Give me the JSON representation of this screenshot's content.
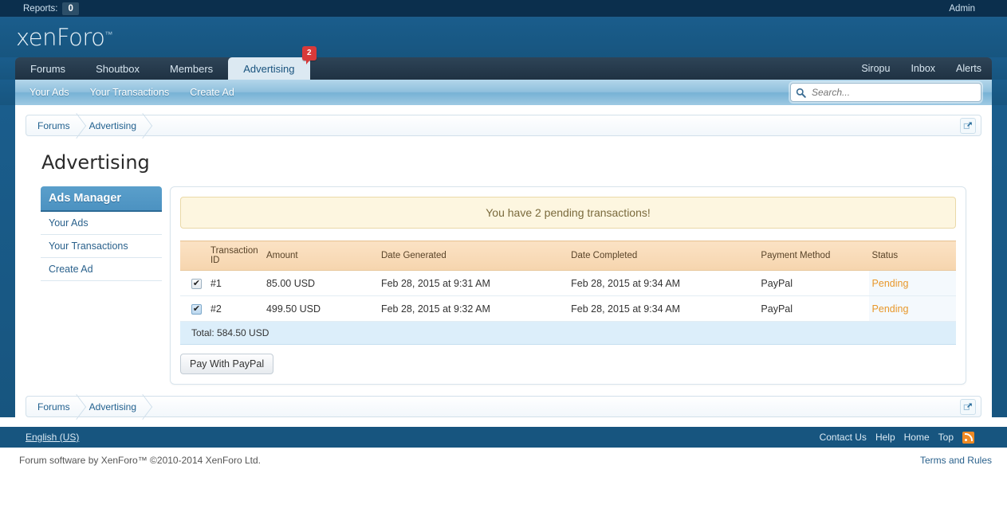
{
  "admin_bar": {
    "reports_label": "Reports:",
    "reports_count": "0",
    "admin_link": "Admin"
  },
  "header": {
    "logo_text": "xenForo",
    "logo_tm": "™"
  },
  "nav": {
    "tabs": [
      {
        "label": "Forums",
        "selected": false
      },
      {
        "label": "Shoutbox",
        "selected": false
      },
      {
        "label": "Members",
        "selected": false
      },
      {
        "label": "Advertising",
        "selected": true,
        "badge": "2"
      }
    ],
    "right_tabs": [
      {
        "label": "Siropu"
      },
      {
        "label": "Inbox"
      },
      {
        "label": "Alerts"
      }
    ]
  },
  "subnav": {
    "items": [
      {
        "label": "Your Ads"
      },
      {
        "label": "Your Transactions"
      },
      {
        "label": "Create Ad"
      }
    ],
    "search_placeholder": "Search...",
    "search_value": ""
  },
  "breadcrumb": {
    "items": [
      {
        "label": "Forums"
      },
      {
        "label": "Advertising"
      }
    ]
  },
  "page": {
    "title": "Advertising"
  },
  "sidebar": {
    "heading": "Ads Manager",
    "items": [
      {
        "label": "Your Ads"
      },
      {
        "label": "Your Transactions"
      },
      {
        "label": "Create Ad"
      }
    ]
  },
  "panel": {
    "notice": "You have 2 pending transactions!",
    "table": {
      "columns": [
        "",
        "Transaction ID",
        "Amount",
        "Date Generated",
        "Date Completed",
        "Payment Method",
        "Status"
      ],
      "rows": [
        {
          "checked": true,
          "id": "#1",
          "amount": "85.00 USD",
          "date_generated": "Feb 28, 2015 at 9:31 AM",
          "date_completed": "Feb 28, 2015 at 9:34 AM",
          "payment_method": "PayPal",
          "status": "Pending"
        },
        {
          "checked": true,
          "id": "#2",
          "amount": "499.50 USD",
          "date_generated": "Feb 28, 2015 at 9:32 AM",
          "date_completed": "Feb 28, 2015 at 9:34 AM",
          "payment_method": "PayPal",
          "status": "Pending"
        }
      ],
      "total": "Total: 584.50 USD"
    },
    "pay_button": "Pay With PayPal"
  },
  "footer": {
    "language": "English (US)",
    "links": [
      {
        "label": "Contact Us"
      },
      {
        "label": "Help"
      },
      {
        "label": "Home"
      },
      {
        "label": "Top"
      }
    ],
    "rss_icon": "rss-icon",
    "copyright": "Forum software by XenForo™ ©2010-2014 XenForo Ltd.",
    "terms": "Terms and Rules"
  },
  "colors": {
    "header_blue": "#17557f",
    "admin_bar": "#0b2f4d",
    "tab_bar": "#2e4457",
    "selected_tab": "#dce9f2",
    "badge_red": "#d83a3a",
    "notice_bg": "#fdf6e0",
    "table_header": "#f6d5ae",
    "status_pending": "#e8972a",
    "total_bg": "#dceefa",
    "rss_orange": "#f08a24"
  }
}
